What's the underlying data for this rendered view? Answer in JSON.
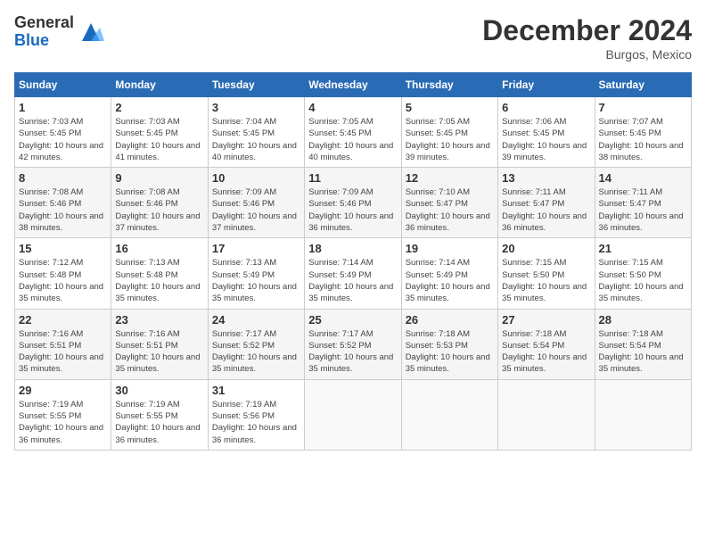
{
  "logo": {
    "general": "General",
    "blue": "Blue"
  },
  "header": {
    "title": "December 2024",
    "location": "Burgos, Mexico"
  },
  "weekdays": [
    "Sunday",
    "Monday",
    "Tuesday",
    "Wednesday",
    "Thursday",
    "Friday",
    "Saturday"
  ],
  "weeks": [
    [
      {
        "day": "1",
        "sunrise": "7:03 AM",
        "sunset": "5:45 PM",
        "daylight": "10 hours and 42 minutes."
      },
      {
        "day": "2",
        "sunrise": "7:03 AM",
        "sunset": "5:45 PM",
        "daylight": "10 hours and 41 minutes."
      },
      {
        "day": "3",
        "sunrise": "7:04 AM",
        "sunset": "5:45 PM",
        "daylight": "10 hours and 40 minutes."
      },
      {
        "day": "4",
        "sunrise": "7:05 AM",
        "sunset": "5:45 PM",
        "daylight": "10 hours and 40 minutes."
      },
      {
        "day": "5",
        "sunrise": "7:05 AM",
        "sunset": "5:45 PM",
        "daylight": "10 hours and 39 minutes."
      },
      {
        "day": "6",
        "sunrise": "7:06 AM",
        "sunset": "5:45 PM",
        "daylight": "10 hours and 39 minutes."
      },
      {
        "day": "7",
        "sunrise": "7:07 AM",
        "sunset": "5:45 PM",
        "daylight": "10 hours and 38 minutes."
      }
    ],
    [
      {
        "day": "8",
        "sunrise": "7:08 AM",
        "sunset": "5:46 PM",
        "daylight": "10 hours and 38 minutes."
      },
      {
        "day": "9",
        "sunrise": "7:08 AM",
        "sunset": "5:46 PM",
        "daylight": "10 hours and 37 minutes."
      },
      {
        "day": "10",
        "sunrise": "7:09 AM",
        "sunset": "5:46 PM",
        "daylight": "10 hours and 37 minutes."
      },
      {
        "day": "11",
        "sunrise": "7:09 AM",
        "sunset": "5:46 PM",
        "daylight": "10 hours and 36 minutes."
      },
      {
        "day": "12",
        "sunrise": "7:10 AM",
        "sunset": "5:47 PM",
        "daylight": "10 hours and 36 minutes."
      },
      {
        "day": "13",
        "sunrise": "7:11 AM",
        "sunset": "5:47 PM",
        "daylight": "10 hours and 36 minutes."
      },
      {
        "day": "14",
        "sunrise": "7:11 AM",
        "sunset": "5:47 PM",
        "daylight": "10 hours and 36 minutes."
      }
    ],
    [
      {
        "day": "15",
        "sunrise": "7:12 AM",
        "sunset": "5:48 PM",
        "daylight": "10 hours and 35 minutes."
      },
      {
        "day": "16",
        "sunrise": "7:13 AM",
        "sunset": "5:48 PM",
        "daylight": "10 hours and 35 minutes."
      },
      {
        "day": "17",
        "sunrise": "7:13 AM",
        "sunset": "5:49 PM",
        "daylight": "10 hours and 35 minutes."
      },
      {
        "day": "18",
        "sunrise": "7:14 AM",
        "sunset": "5:49 PM",
        "daylight": "10 hours and 35 minutes."
      },
      {
        "day": "19",
        "sunrise": "7:14 AM",
        "sunset": "5:49 PM",
        "daylight": "10 hours and 35 minutes."
      },
      {
        "day": "20",
        "sunrise": "7:15 AM",
        "sunset": "5:50 PM",
        "daylight": "10 hours and 35 minutes."
      },
      {
        "day": "21",
        "sunrise": "7:15 AM",
        "sunset": "5:50 PM",
        "daylight": "10 hours and 35 minutes."
      }
    ],
    [
      {
        "day": "22",
        "sunrise": "7:16 AM",
        "sunset": "5:51 PM",
        "daylight": "10 hours and 35 minutes."
      },
      {
        "day": "23",
        "sunrise": "7:16 AM",
        "sunset": "5:51 PM",
        "daylight": "10 hours and 35 minutes."
      },
      {
        "day": "24",
        "sunrise": "7:17 AM",
        "sunset": "5:52 PM",
        "daylight": "10 hours and 35 minutes."
      },
      {
        "day": "25",
        "sunrise": "7:17 AM",
        "sunset": "5:52 PM",
        "daylight": "10 hours and 35 minutes."
      },
      {
        "day": "26",
        "sunrise": "7:18 AM",
        "sunset": "5:53 PM",
        "daylight": "10 hours and 35 minutes."
      },
      {
        "day": "27",
        "sunrise": "7:18 AM",
        "sunset": "5:54 PM",
        "daylight": "10 hours and 35 minutes."
      },
      {
        "day": "28",
        "sunrise": "7:18 AM",
        "sunset": "5:54 PM",
        "daylight": "10 hours and 35 minutes."
      }
    ],
    [
      {
        "day": "29",
        "sunrise": "7:19 AM",
        "sunset": "5:55 PM",
        "daylight": "10 hours and 36 minutes."
      },
      {
        "day": "30",
        "sunrise": "7:19 AM",
        "sunset": "5:55 PM",
        "daylight": "10 hours and 36 minutes."
      },
      {
        "day": "31",
        "sunrise": "7:19 AM",
        "sunset": "5:56 PM",
        "daylight": "10 hours and 36 minutes."
      },
      null,
      null,
      null,
      null
    ]
  ],
  "labels": {
    "sunrise": "Sunrise:",
    "sunset": "Sunset:",
    "daylight": "Daylight:"
  }
}
